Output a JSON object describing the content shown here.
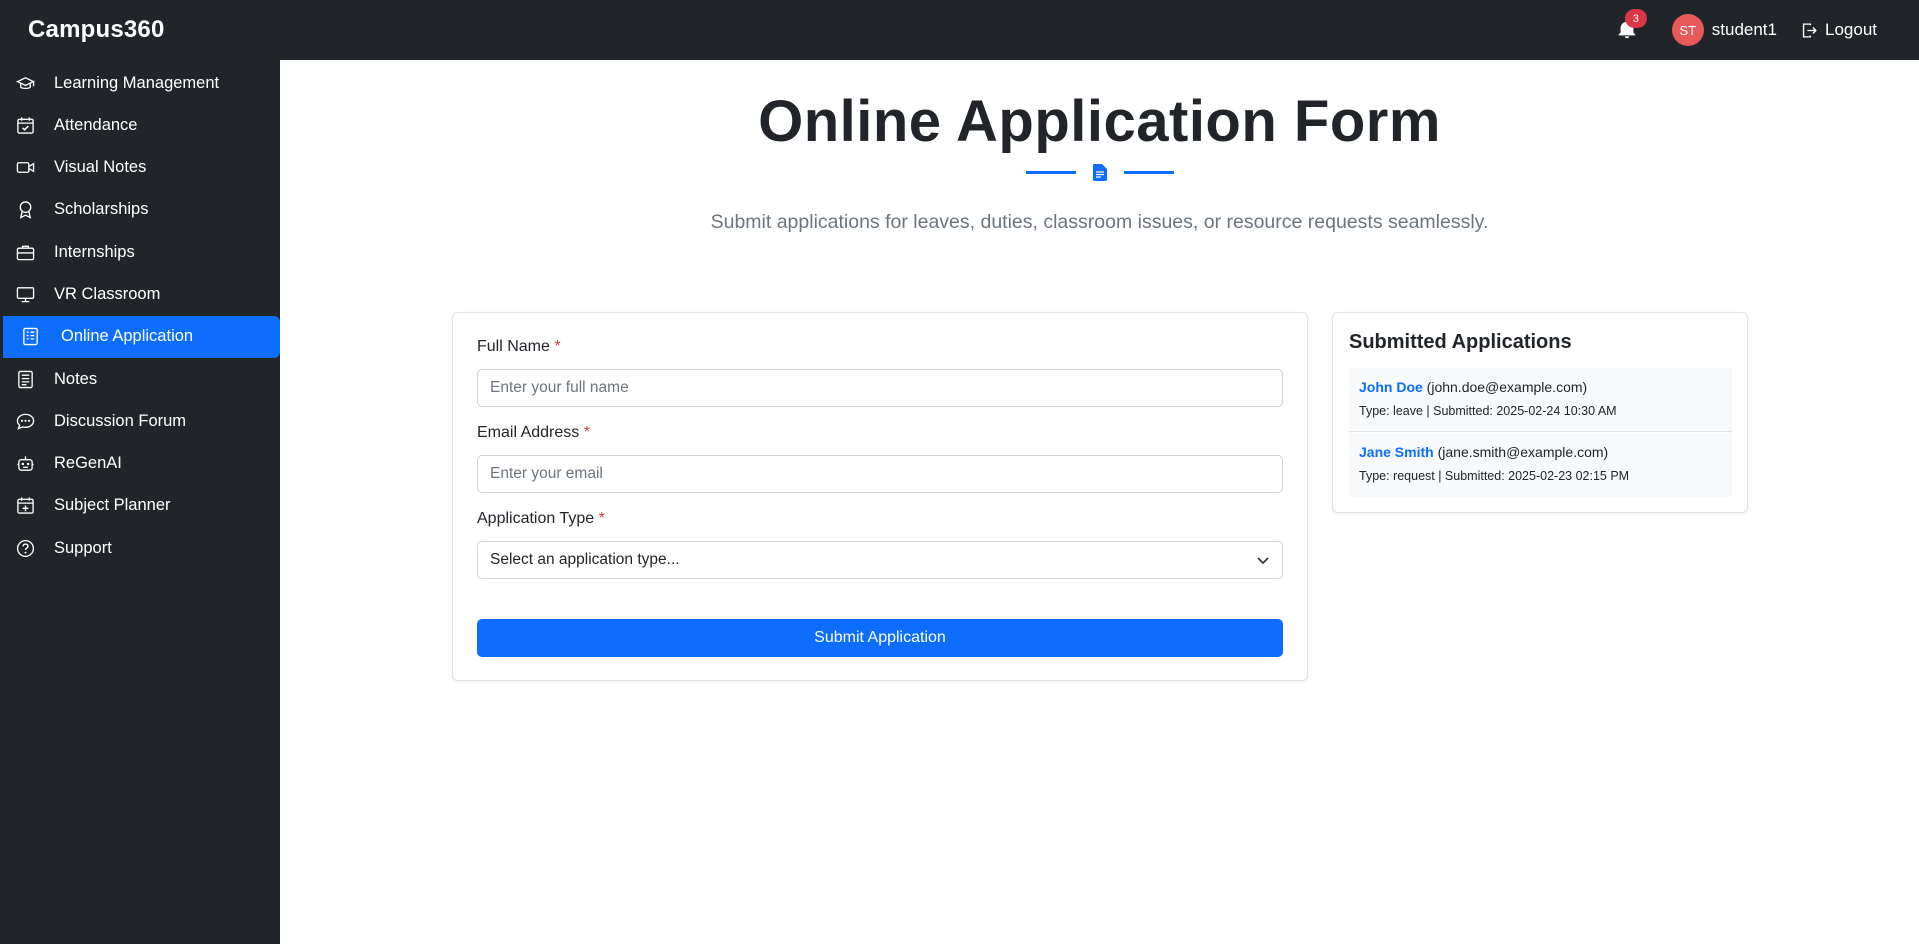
{
  "app": {
    "brand": "Campus360"
  },
  "topbar": {
    "notification_count": "3",
    "avatar_initials": "ST",
    "username": "student1",
    "logout_label": "Logout"
  },
  "sidebar": {
    "items": [
      {
        "label": "Learning Management",
        "icon": "graduation-cap-icon"
      },
      {
        "label": "Attendance",
        "icon": "calendar-check-icon"
      },
      {
        "label": "Visual Notes",
        "icon": "video-camera-icon"
      },
      {
        "label": "Scholarships",
        "icon": "award-icon"
      },
      {
        "label": "Internships",
        "icon": "briefcase-icon"
      },
      {
        "label": "VR Classroom",
        "icon": "monitor-icon"
      },
      {
        "label": "Online Application",
        "icon": "document-text-icon",
        "active": true
      },
      {
        "label": "Notes",
        "icon": "notes-icon"
      },
      {
        "label": "Discussion Forum",
        "icon": "chat-dots-icon"
      },
      {
        "label": "ReGenAI",
        "icon": "robot-icon"
      },
      {
        "label": "Subject Planner",
        "icon": "calendar-plus-icon"
      },
      {
        "label": "Support",
        "icon": "question-circle-icon"
      }
    ]
  },
  "main": {
    "title": "Online Application Form",
    "subtitle": "Submit applications for leaves, duties, classroom issues, or resource requests seamlessly."
  },
  "form": {
    "full_name_label": "Full Name",
    "full_name_placeholder": "Enter your full name",
    "full_name_value": "",
    "email_label": "Email Address",
    "email_placeholder": "Enter your email",
    "email_value": "",
    "type_label": "Application Type",
    "type_selected": "Select an application type...",
    "required_mark": "*",
    "submit_label": "Submit Application"
  },
  "submitted": {
    "title": "Submitted Applications",
    "items": [
      {
        "name": "John Doe",
        "email": "(john.doe@example.com)",
        "meta": "Type: leave | Submitted: 2025-02-24 10:30 AM"
      },
      {
        "name": "Jane Smith",
        "email": "(jane.smith@example.com)",
        "meta": "Type: request | Submitted: 2025-02-23 02:15 PM"
      }
    ]
  },
  "colors": {
    "navbar": "#212529",
    "accent": "#0d6efd",
    "required": "#dc3545",
    "avatar": "#e85a5a"
  }
}
